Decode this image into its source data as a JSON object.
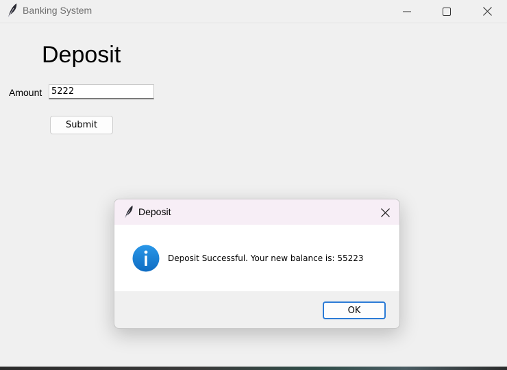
{
  "window": {
    "title": "Banking System",
    "icon": "feather-icon",
    "controls": [
      "minimize-icon",
      "maximize-icon",
      "close-icon"
    ]
  },
  "form": {
    "heading": "Deposit",
    "amount_label": "Amount",
    "amount_value": "5222",
    "submit_label": "Submit"
  },
  "dialog": {
    "title": "Deposit",
    "icon": "info-icon",
    "message": "Deposit Successful. Your new balance is: 55223",
    "ok_label": "OK"
  },
  "colors": {
    "info_blue": "#1a7fd4",
    "focus_border": "#2b7bd6",
    "dialog_title_bg": "#f7eef6"
  }
}
